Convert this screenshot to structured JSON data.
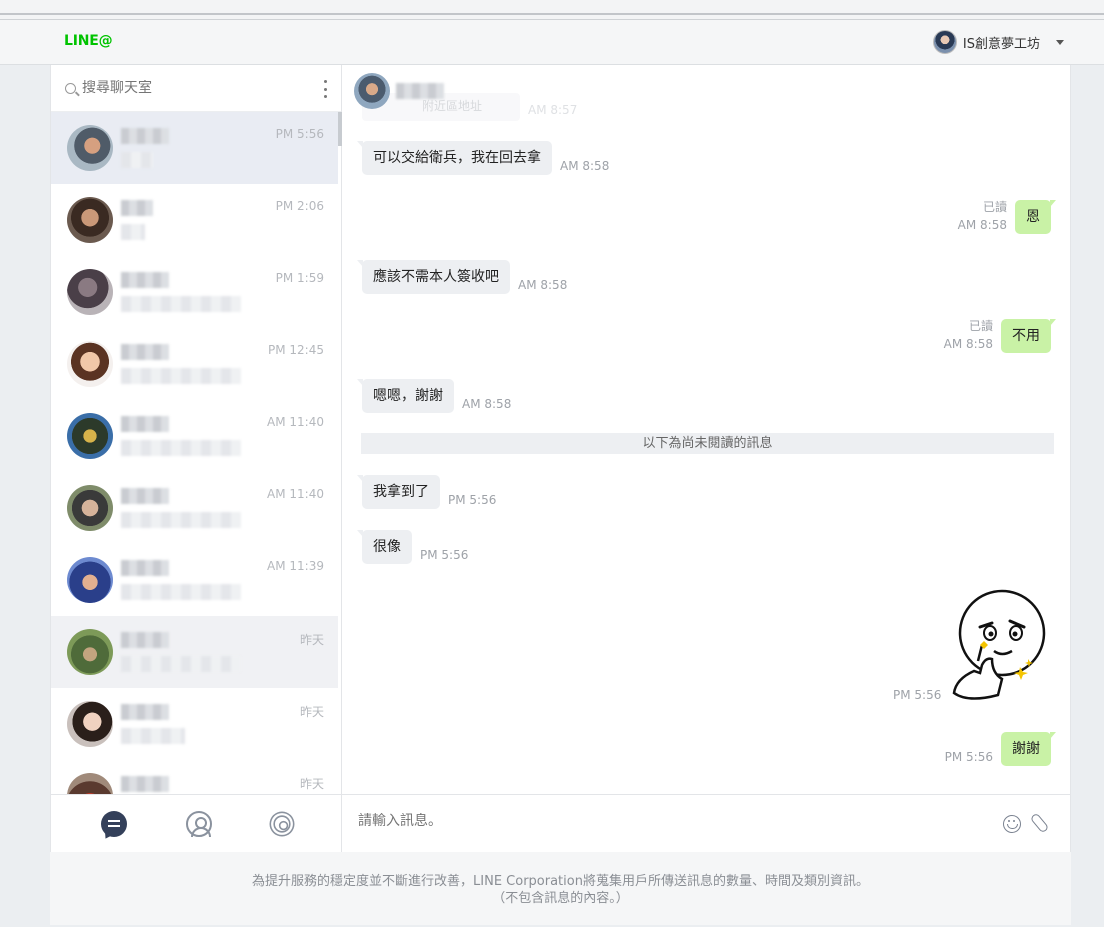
{
  "header": {
    "logo": "LINE@",
    "account_name": "IS創意夢工坊"
  },
  "sidebar": {
    "search_placeholder": "搜尋聊天室",
    "chats": [
      {
        "time": "PM 5:56",
        "preview_width": 32,
        "active": true
      },
      {
        "time": "PM 2:06",
        "preview_width": 24
      },
      {
        "time": "PM 1:59",
        "preview_width": 120
      },
      {
        "time": "PM 12:45",
        "preview_width": 120
      },
      {
        "time": "AM 11:40",
        "preview_width": 120
      },
      {
        "time": "AM 11:40",
        "preview_width": 120
      },
      {
        "time": "AM 11:39",
        "preview_width": 120
      },
      {
        "time": "昨天",
        "preview_width": 120,
        "hover": true
      },
      {
        "time": "昨天",
        "preview_width": 64
      },
      {
        "time": "昨天",
        "preview_width": 0
      }
    ]
  },
  "messages": [
    {
      "dir": "in",
      "text": "可以交給衛兵，我在回去拿",
      "time": "AM 8:58"
    },
    {
      "dir": "out",
      "text": "恩",
      "read": "已讀",
      "time": "AM 8:58"
    },
    {
      "dir": "in",
      "text": "應該不需本人簽收吧",
      "time": "AM 8:58"
    },
    {
      "dir": "out",
      "text": "不用",
      "read": "已讀",
      "time": "AM 8:58"
    },
    {
      "dir": "in",
      "text": "嗯嗯，謝謝",
      "time": "AM 8:58"
    },
    {
      "dir": "in",
      "text": "我拿到了",
      "time": "PM 5:56"
    },
    {
      "dir": "in",
      "text": "很像",
      "time": "PM 5:56"
    },
    {
      "dir": "out",
      "text": "謝謝",
      "time": "PM 5:56"
    }
  ],
  "faded_preview": {
    "text": "附近區地址",
    "time": "AM 8:57"
  },
  "unread_label": "以下為尚未閱讀的訊息",
  "sticker_time": "PM 5:56",
  "composer": {
    "placeholder": "請輸入訊息。"
  },
  "footer": {
    "line1": "為提升服務的穩定度並不斷進行改善，LINE Corporation將蒐集用戶所傳送訊息的數量、時間及類別資訊。",
    "line2": "（不包含訊息的內容。）"
  },
  "colors": {
    "brand": "#00c300",
    "bubble_out": "#c9f2a6",
    "bubble_in": "#edeff2"
  }
}
